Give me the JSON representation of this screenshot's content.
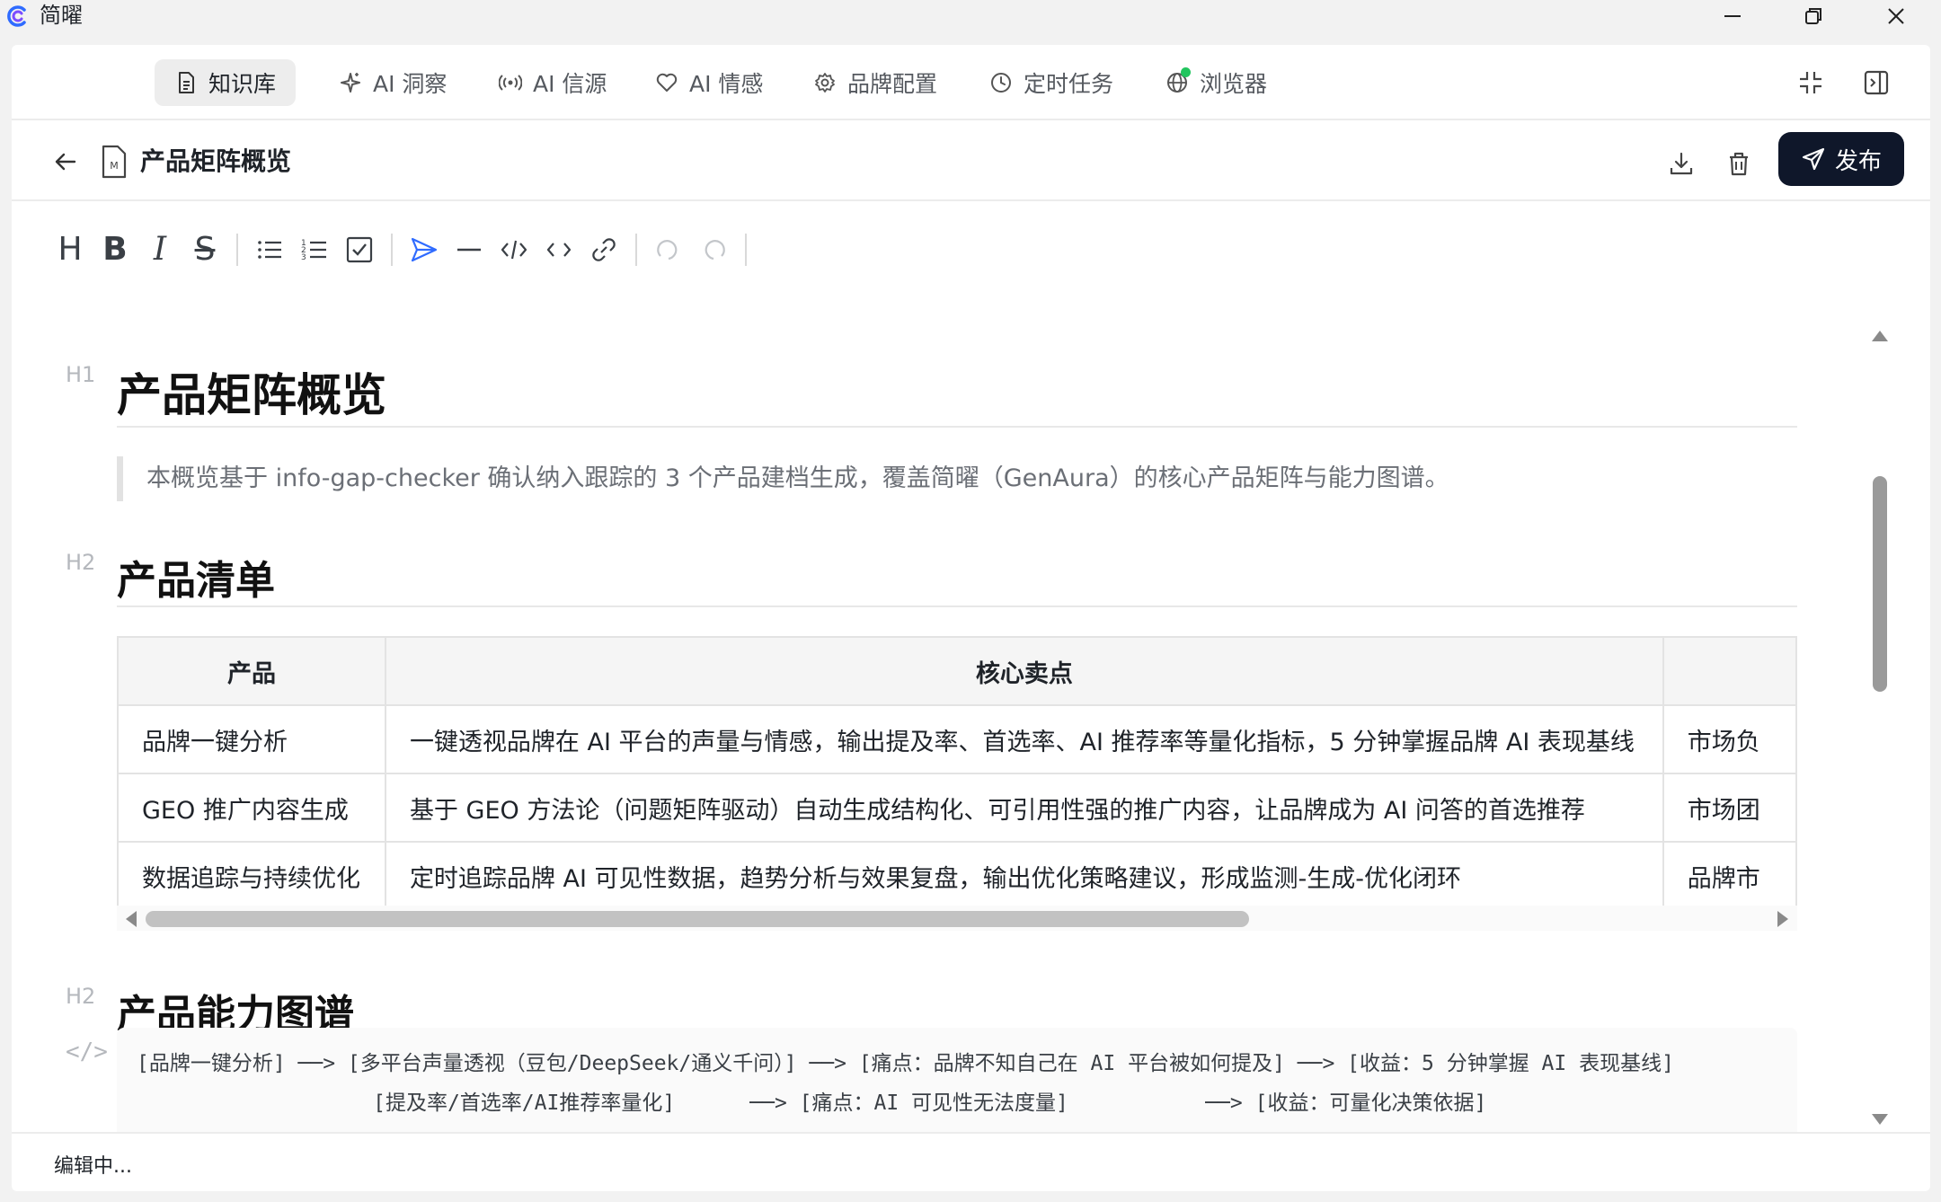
{
  "app": {
    "name": "简曜"
  },
  "nav": {
    "tabs": [
      {
        "label": "知识库",
        "icon": "document-icon",
        "active": true
      },
      {
        "label": "AI 洞察",
        "icon": "sparkle-icon",
        "active": false
      },
      {
        "label": "AI 信源",
        "icon": "broadcast-icon",
        "active": false
      },
      {
        "label": "AI 情感",
        "icon": "heart-icon",
        "active": false
      },
      {
        "label": "品牌配置",
        "icon": "gear-icon",
        "active": false
      },
      {
        "label": "定时任务",
        "icon": "clock-icon",
        "active": false
      },
      {
        "label": "浏览器",
        "icon": "globe-icon",
        "active": false,
        "status_dot": "#22c55e"
      }
    ]
  },
  "doc": {
    "title": "产品矩阵概览",
    "publish_label": "发布"
  },
  "toolbar": {
    "heading": "H",
    "bold": "B",
    "italic": "I",
    "strike": "S"
  },
  "editor": {
    "h1_label": "H1",
    "h1": "产品矩阵概览",
    "quote": "本概览基于 info-gap-checker 确认纳入跟踪的 3 个产品建档生成，覆盖简曜（GenAura）的核心产品矩阵与能力图谱。",
    "section1": {
      "label": "H2",
      "title": "产品清单"
    },
    "table": {
      "headers": [
        "产品",
        "核心卖点",
        ""
      ],
      "rows": [
        [
          "品牌一键分析",
          "一键透视品牌在 AI 平台的声量与情感，输出提及率、首选率、AI 推荐率等量化指标，5 分钟掌握品牌 AI 表现基线",
          "市场负"
        ],
        [
          "GEO 推广内容生成",
          "基于 GEO 方法论（问题矩阵驱动）自动生成结构化、可引用性强的推广内容，让品牌成为 AI 问答的首选推荐",
          "市场团"
        ],
        [
          "数据追踪与持续优化",
          "定时追踪品牌 AI 可见性数据，趋势分析与效果复盘，输出优化策略建议，形成监测-生成-优化闭环",
          "品牌市"
        ]
      ]
    },
    "section2": {
      "label": "H2",
      "title": "产品能力图谱"
    },
    "code_label": "</>",
    "code_lines": [
      "[品牌一键分析] ──> [多平台声量透视（豆包/DeepSeek/通义千问）] ──> [痛点：品牌不知自己在 AI 平台被如何提及] ──> [收益：5 分钟掌握 AI 表现基线]",
      "                   [提及率/首选率/AI推荐率量化]      ──> [痛点：AI 可见性无法度量]           ──> [收益：可量化决策依据]"
    ]
  },
  "status": {
    "text": "编辑中..."
  }
}
